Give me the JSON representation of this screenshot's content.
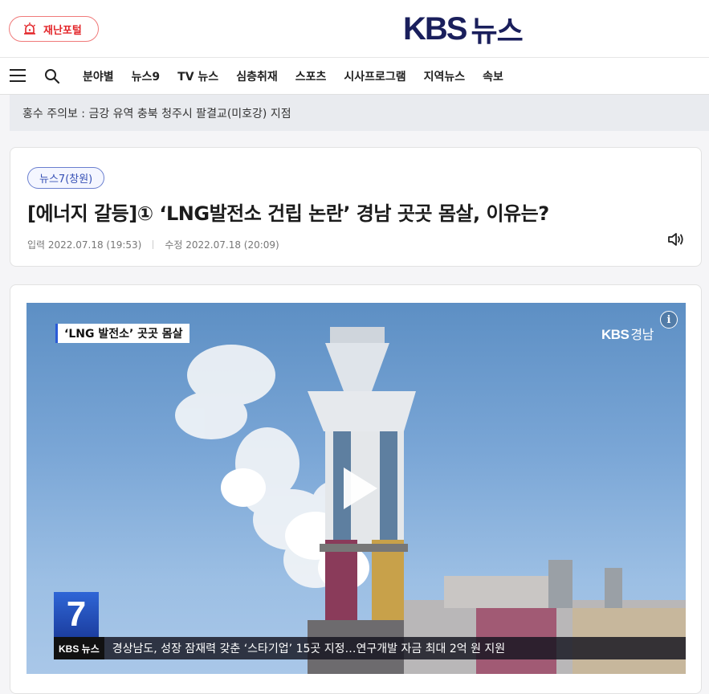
{
  "header": {
    "disaster_label": "재난포털",
    "logo_kbs": "KBS",
    "logo_news": "뉴스"
  },
  "nav": {
    "items": [
      "분야별",
      "뉴스9",
      "TV 뉴스",
      "심층취재",
      "스포츠",
      "시사프로그램",
      "지역뉴스",
      "속보"
    ]
  },
  "alert": {
    "text": "홍수 주의보 : 금강 유역 충북 청주시 팔결교(미호강) 지점"
  },
  "article": {
    "program_tag": "뉴스7(창원)",
    "title": "[에너지 갈등]① ‘LNG발전소 건립 논란’ 경남 곳곳 몸살, 이유는?",
    "input_date": "입력 2022.07.18 (19:53)",
    "edit_date": "수정 2022.07.18 (20:09)"
  },
  "video": {
    "caption_tag": "‘LNG 발전소’ 곳곳 몸살",
    "channel_logo": "KBS",
    "channel_sub": "경남",
    "badge": "7",
    "ticker_brand": "KBS 뉴스",
    "ticker_text": "경상남도, 성장 잠재력 갖춘 ‘스타기업’ 15곳 지정…연구개발 자금 최대 2억 원 지원",
    "info_label": "i"
  },
  "colors": {
    "brand_navy": "#1a1f5c",
    "disaster_red": "#e3262a",
    "tag_blue": "#3751b5"
  }
}
